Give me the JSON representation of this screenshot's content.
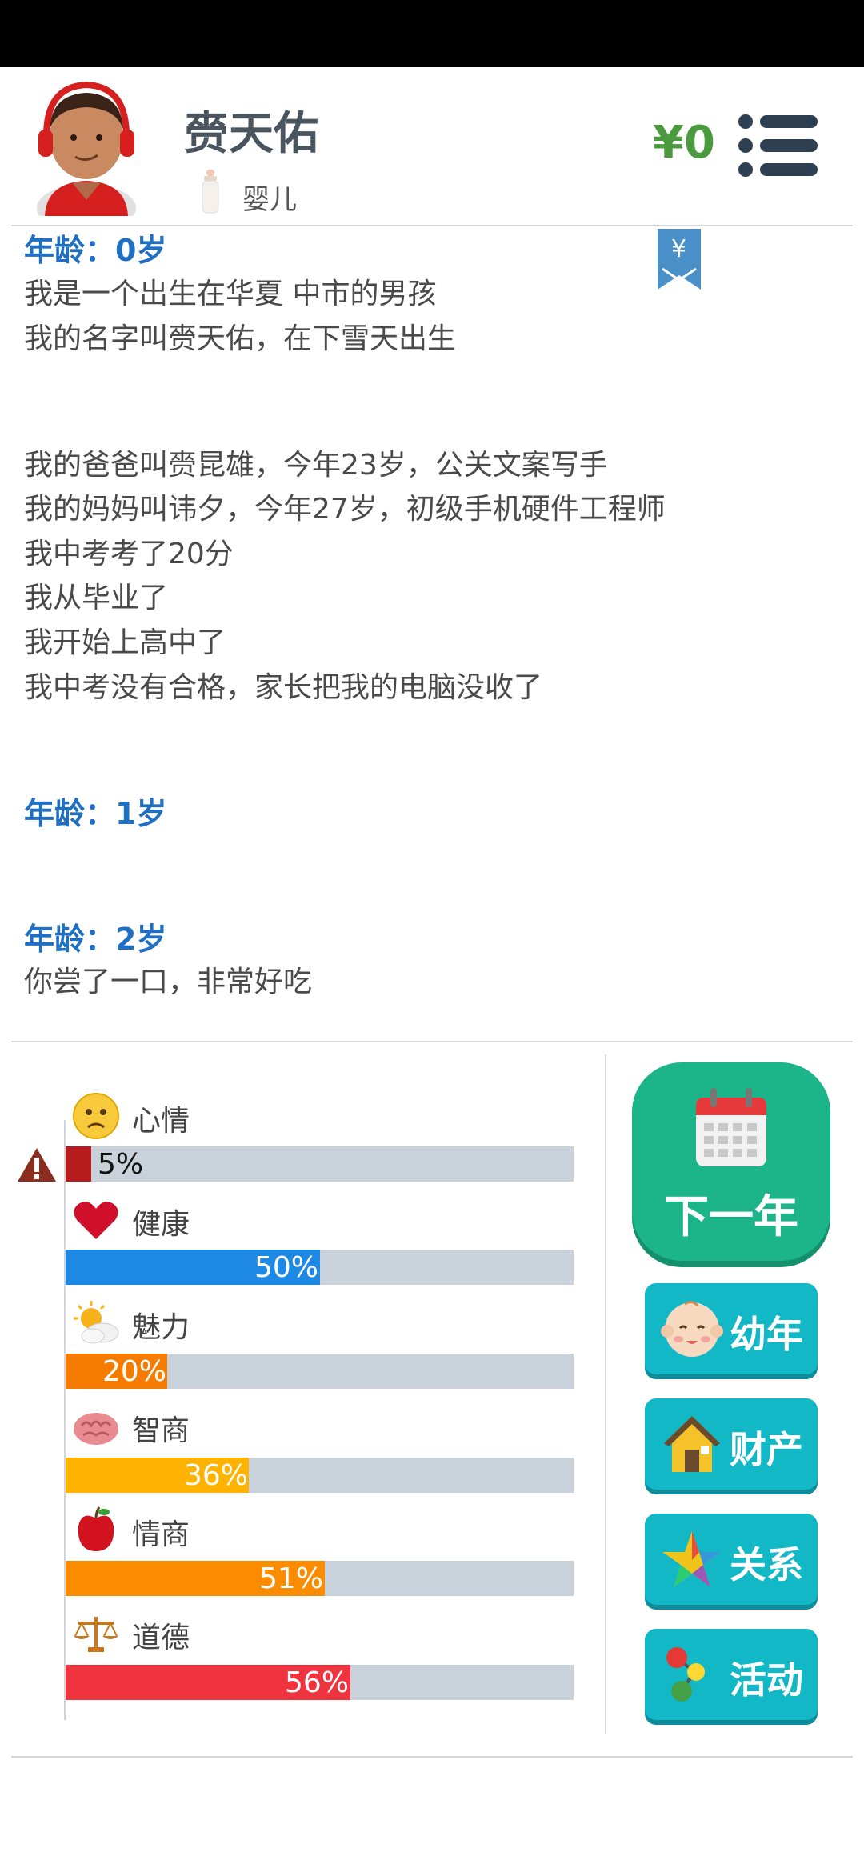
{
  "header": {
    "name": "赍天佑",
    "stage": "婴儿",
    "money": "¥0"
  },
  "log": {
    "bookmark_symbol": "¥",
    "entries": [
      {
        "age": "年龄：0岁",
        "lines": [
          "我是一个出生在华夏 中市的男孩",
          "我的名字叫赍天佑，在下雪天出生",
          "我的爸爸叫赍昆雄，今年23岁，公关文案写手",
          "我的妈妈叫讳夕，今年27岁，初级手机硬件工程师",
          "我中考考了20分",
          "我从毕业了",
          "我开始上高中了",
          "我中考没有合格，家长把我的电脑没收了"
        ]
      },
      {
        "age": "年龄：1岁",
        "lines": []
      },
      {
        "age": "年龄：2岁",
        "lines": [
          "你尝了一口，非常好吃"
        ]
      }
    ]
  },
  "stats": [
    {
      "label": "心情",
      "value": 5,
      "pct": "5%",
      "color": "#b71c1c",
      "icon": "sad-face-icon"
    },
    {
      "label": "健康",
      "value": 50,
      "pct": "50%",
      "color": "#1e88e5",
      "icon": "heart-icon"
    },
    {
      "label": "魅力",
      "value": 20,
      "pct": "20%",
      "color": "#f57c00",
      "icon": "sun-cloud-icon"
    },
    {
      "label": "智商",
      "value": 36,
      "pct": "36%",
      "color": "#ffb300",
      "icon": "brain-icon"
    },
    {
      "label": "情商",
      "value": 51,
      "pct": "51%",
      "color": "#fb8c00",
      "icon": "apple-icon"
    },
    {
      "label": "道德",
      "value": 56,
      "pct": "56%",
      "color": "#f0343f",
      "icon": "scales-icon"
    }
  ],
  "buttons": {
    "next_year": "下一年",
    "childhood": "幼年",
    "assets": "财产",
    "relations": "关系",
    "activities": "活动"
  },
  "colors": {
    "next_year_bg": "#1cb58a",
    "side_button_bg": "#13b8c6",
    "age_heading": "#1f6fc4",
    "money": "#4c9a3f"
  }
}
